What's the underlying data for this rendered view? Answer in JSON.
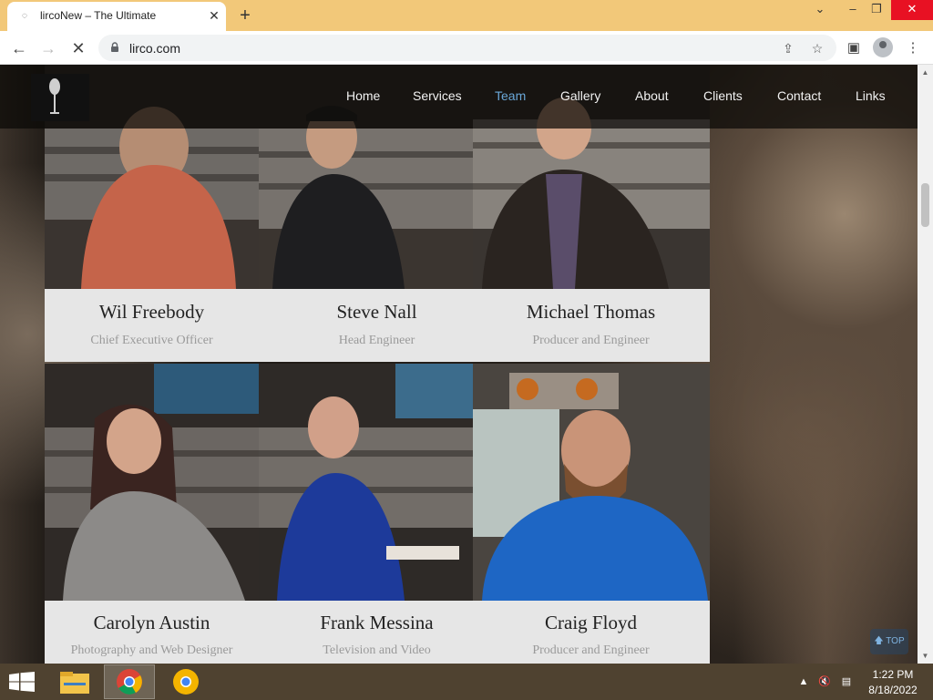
{
  "browser": {
    "tab_title": "lircoNew – The Ultimate",
    "url": "lirco.com",
    "new_tab_symbol": "+",
    "close_tab_symbol": "✕"
  },
  "site": {
    "menu": [
      {
        "label": "Home",
        "active": false
      },
      {
        "label": "Services",
        "active": false
      },
      {
        "label": "Team",
        "active": true
      },
      {
        "label": "Gallery",
        "active": false
      },
      {
        "label": "About",
        "active": false
      },
      {
        "label": "Clients",
        "active": false
      },
      {
        "label": "Contact",
        "active": false
      },
      {
        "label": "Links",
        "active": false
      }
    ],
    "accent_color": "#6aa7d8",
    "top_button": "TOP"
  },
  "team": [
    {
      "name": "Wil Freebody",
      "role": "Chief Executive Officer"
    },
    {
      "name": "Steve Nall",
      "role": "Head Engineer"
    },
    {
      "name": "Michael Thomas",
      "role": "Producer and Engineer"
    },
    {
      "name": "Carolyn Austin",
      "role": "Photography and Web Designer"
    },
    {
      "name": "Frank Messina",
      "role": "Television and Video"
    },
    {
      "name": "Craig Floyd",
      "role": "Producer and Engineer"
    }
  ],
  "taskbar": {
    "time": "1:22 PM",
    "date": "8/18/2022"
  }
}
